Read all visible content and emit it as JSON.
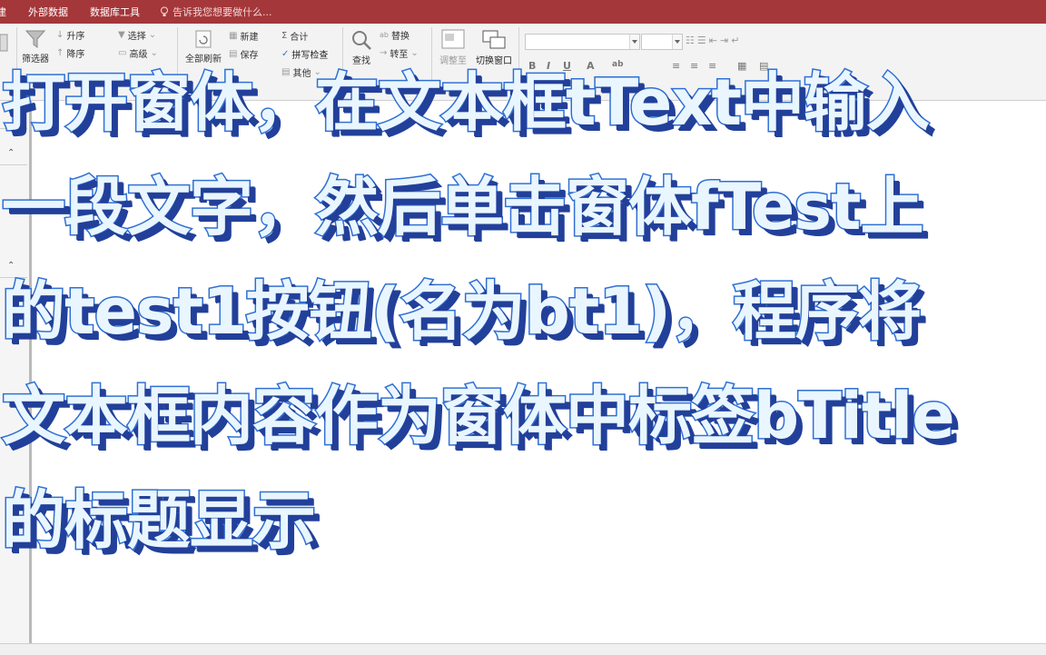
{
  "tabs": {
    "create_partial": "建",
    "external_data": "外部数据",
    "db_tools": "数据库工具",
    "tell_me": "告诉我您想要做什么..."
  },
  "ribbon": {
    "filter": "筛选器",
    "ascending": "升序",
    "descending": "降序",
    "selection": "选择",
    "advanced": "高级",
    "refresh_all": "全部刷新",
    "new": "新建",
    "save": "保存",
    "totals": "合计",
    "spelling": "拼写检查",
    "more": "其他",
    "find": "查找",
    "replace": "替换",
    "goto": "转至",
    "size_to_fit": "调整至",
    "switch_windows": "切换窗口"
  },
  "caption": {
    "lines": [
      "打开窗体，在文本框tText中输入",
      "一段文字，然后单击窗体fTest上",
      "的test1按钮(名为bt1)，程序将",
      "文本框内容作为窗体中标签bTitle",
      "的标题显示"
    ]
  },
  "colors": {
    "title_bar": "#a4373a",
    "caption_fill": "#e9f6ff",
    "caption_stroke": "#2f6fd4",
    "caption_shadow": "#22409a"
  }
}
